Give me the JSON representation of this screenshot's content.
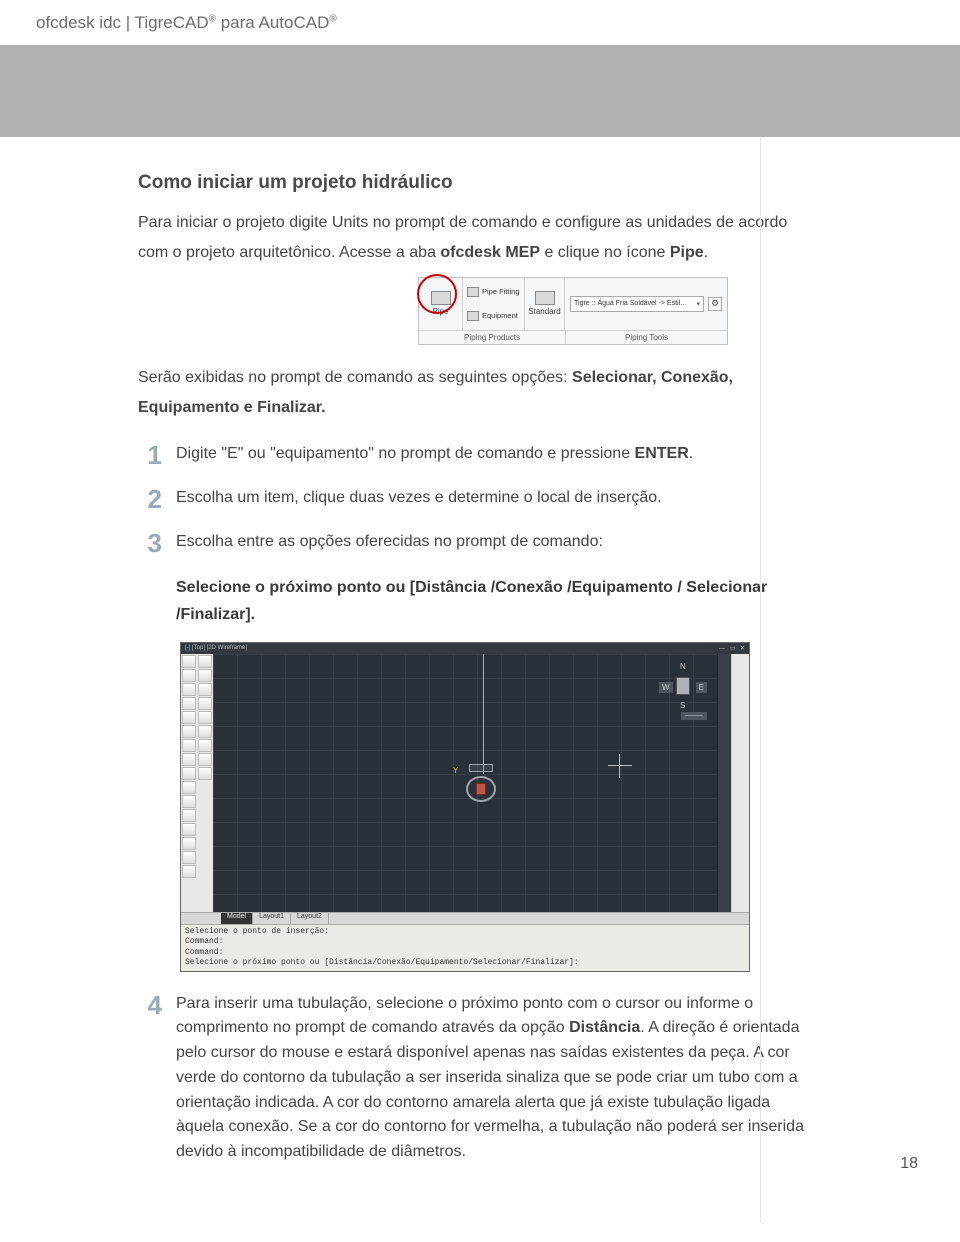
{
  "header": {
    "brand": "ofcdesk idc | TigreCAD",
    "suffix": " para AutoCAD"
  },
  "section_title": "Como iniciar um projeto hidráulico",
  "intro_a": "Para iniciar o projeto digite Units no prompt de comando e configure as unidades de acordo com o projeto arquitetônico. Acesse a aba ",
  "intro_b_bold": "ofcdesk MEP",
  "intro_c": " e clique no ícone ",
  "intro_d_bold": "Pipe",
  "intro_e": ".",
  "ribbon": {
    "pipe": "Pipe",
    "pipe_fitting": "Pipe Fitting",
    "equipment": "Equipment",
    "standard": "Standard",
    "dropdown": "Tigre :: Água Fria Soldável -> Estil…",
    "group1": "Piping Products",
    "group2": "Piping Tools"
  },
  "after_ribbon_a": "Serão exibidas no prompt de comando as seguintes opções: ",
  "after_ribbon_b_bold": "Selecionar, Conexão, Equipamento e Finalizar.",
  "steps": {
    "s1a": "Digite \"E\" ou \"equipamento\" no prompt de comando e pressione ",
    "s1b_bold": "ENTER",
    "s1c": ".",
    "s2": "Escolha um item, clique duas vezes e determine o local de inserção.",
    "s3": "Escolha entre as opções oferecidas no prompt de comando:",
    "s4a": "Para inserir uma tubulação, selecione o próximo ponto com o cursor ou informe o comprimento no prompt de comando através da opção ",
    "s4b_bold": "Distância",
    "s4c": ". A direção é orientada pelo cursor do mouse e estará disponível apenas nas saídas existentes da peça. A cor verde do contorno da tubulação a ser inserida sinaliza que se pode criar um tubo com a orientação indicada. A cor do contorno amarela alerta que já existe tubulação ligada àquela conexão. Se a cor do contorno for vermelha, a tubulação não poderá ser inserida devido à incompatibilidade de diâmetros."
  },
  "bold_prompt": "Selecione o próximo ponto ou [Distância /Conexão /Equipamento / Selecionar /Finalizar].",
  "acad": {
    "title_left": "[-] [Top] [2D Wireframe]",
    "win_min": "—",
    "win_max": "▭",
    "win_close": "✕",
    "tab_model": "Model",
    "tab_l1": "Layout1",
    "tab_l2": "Layout2",
    "compass": {
      "n": "N",
      "s": "S",
      "e": "E",
      "w": "W",
      "label": "———"
    },
    "y": "Y",
    "cmd1": "Selecione o ponto de inserção:",
    "cmd2": "Command:",
    "cmd3": "Command:",
    "cmd4": "Selecione o próximo ponto ou [Distância/Conexão/Equipamento/Selecionar/Finalizar]:"
  },
  "page_number": "18"
}
